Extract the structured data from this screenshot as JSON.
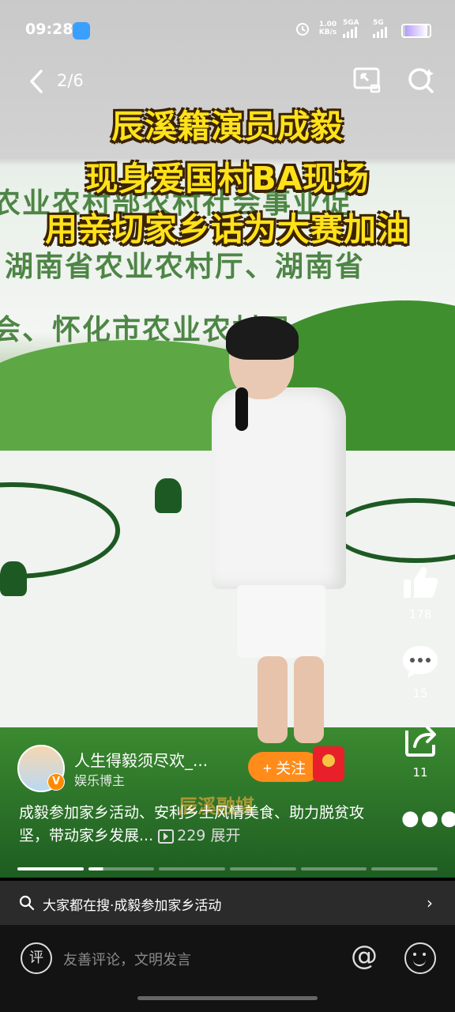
{
  "status_bar": {
    "time": "09:28",
    "net_speed_value": "1.00",
    "net_speed_unit": "KB/s",
    "signal1": "5GA",
    "signal2": "5G"
  },
  "nav": {
    "page_indicator": "2/6"
  },
  "headline": {
    "line1": "辰溪籍演员成毅",
    "line2": "现身爱国村BA现场",
    "line3": "用亲切家乡话为大赛加油"
  },
  "background_banner": {
    "line1": "农业农村部农村社会事业促",
    "line2": "湖南省农业农村厅、湖南省",
    "line3": "会、怀化市农业农村局、怀化"
  },
  "actions": {
    "like_count": "178",
    "comment_count": "15",
    "share_count": "11"
  },
  "author": {
    "name": "人生得毅须尽欢_...",
    "role": "娱乐博主",
    "follow_label": "+ 关注",
    "verified_badge": "V"
  },
  "watermark": "辰溪融媒",
  "post": {
    "description": "成毅参加家乡活动、安利乡土风情美食、助力脱贫攻坚，带动家乡发展...",
    "view_count": "229",
    "expand_label": "展开"
  },
  "search_suggestion": {
    "text": "大家都在搜·成毅参加家乡活动"
  },
  "comment_bar": {
    "icon_label": "评",
    "placeholder": "友善评论，文明发言"
  },
  "colors": {
    "headline_fill": "#ffe21a",
    "follow_button": "#ff8c1a",
    "red_packet": "#e8202a"
  }
}
